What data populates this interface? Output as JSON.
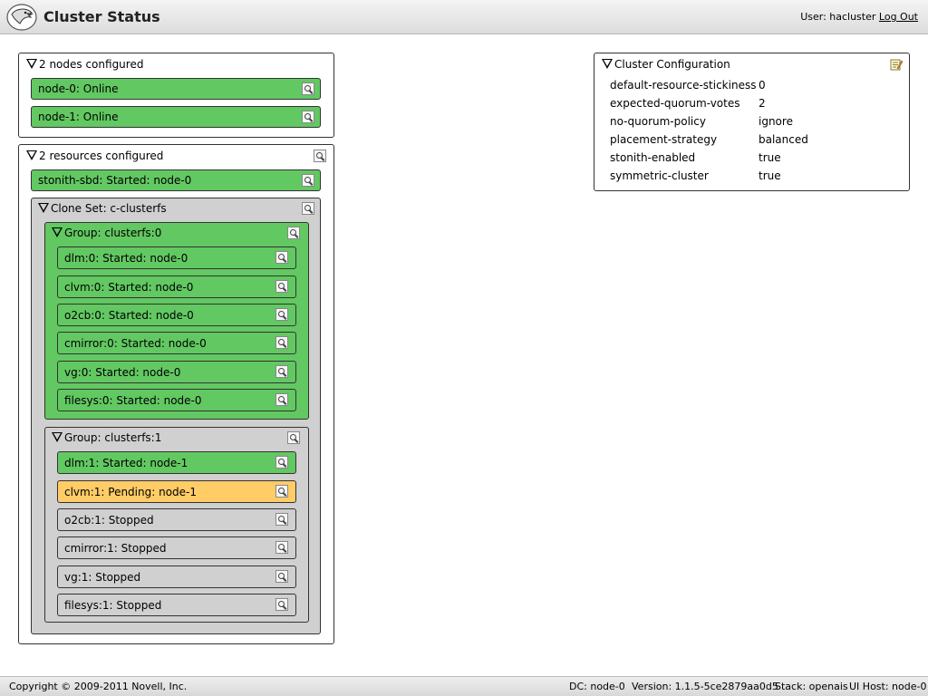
{
  "header": {
    "title": "Cluster Status",
    "user_prefix": "User: hacluster",
    "logout_label": "Log Out"
  },
  "nodes_panel": {
    "title": "2 nodes configured",
    "nodes": [
      {
        "label": "node-0: Online",
        "status": "online"
      },
      {
        "label": "node-1: Online",
        "status": "online"
      }
    ]
  },
  "resources_panel": {
    "title": "2 resources configured",
    "stonith": {
      "label": "stonith-sbd: Started: node-0",
      "status": "started"
    },
    "clone": {
      "label": "Clone Set: c-clusterfs",
      "groups": [
        {
          "label": "Group: clusterfs:0",
          "status": "started",
          "items": [
            {
              "label": "dlm:0: Started: node-0",
              "status": "started"
            },
            {
              "label": "clvm:0: Started: node-0",
              "status": "started"
            },
            {
              "label": "o2cb:0: Started: node-0",
              "status": "started"
            },
            {
              "label": "cmirror:0: Started: node-0",
              "status": "started"
            },
            {
              "label": "vg:0: Started: node-0",
              "status": "started"
            },
            {
              "label": "filesys:0: Started: node-0",
              "status": "started"
            }
          ]
        },
        {
          "label": "Group: clusterfs:1",
          "status": "stopped",
          "items": [
            {
              "label": "dlm:1: Started: node-1",
              "status": "started"
            },
            {
              "label": "clvm:1: Pending: node-1",
              "status": "pending"
            },
            {
              "label": "o2cb:1: Stopped",
              "status": "stopped"
            },
            {
              "label": "cmirror:1: Stopped",
              "status": "stopped"
            },
            {
              "label": "vg:1: Stopped",
              "status": "stopped"
            },
            {
              "label": "filesys:1: Stopped",
              "status": "stopped"
            }
          ]
        }
      ]
    }
  },
  "config_panel": {
    "title": "Cluster Configuration",
    "rows": [
      {
        "key": "default-resource-stickiness",
        "value": "0"
      },
      {
        "key": "expected-quorum-votes",
        "value": "2"
      },
      {
        "key": "no-quorum-policy",
        "value": "ignore"
      },
      {
        "key": "placement-strategy",
        "value": "balanced"
      },
      {
        "key": "stonith-enabled",
        "value": "true"
      },
      {
        "key": "symmetric-cluster",
        "value": "true"
      }
    ]
  },
  "footer": {
    "copyright": "Copyright © 2009-2011 Novell, Inc.",
    "dc": "DC: node-0",
    "version": "Version: 1.1.5-5ce2879aa0d5",
    "stack": "Stack: openais",
    "ui_host": "UI Host: node-0"
  },
  "colors": {
    "started": "#62c862",
    "pending": "#ffcc66",
    "stopped": "#d0d0d0"
  },
  "icons": [
    "eagle-logo-icon",
    "magnifier-icon",
    "edit-icon",
    "collapse-triangle-icon"
  ]
}
